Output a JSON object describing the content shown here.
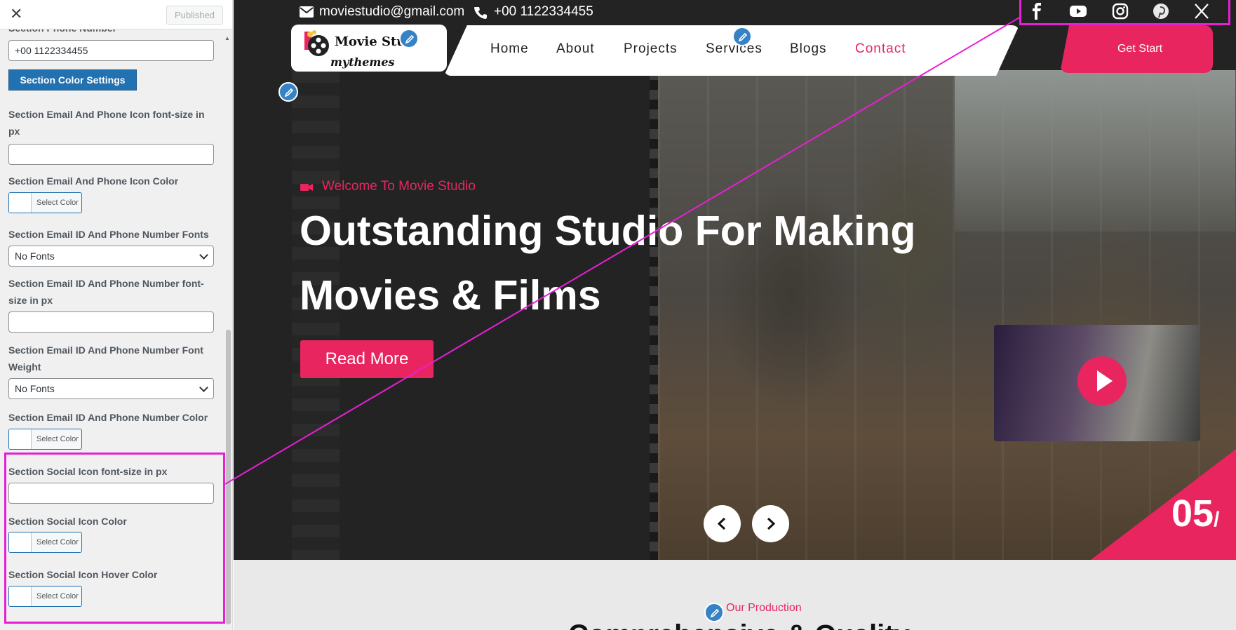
{
  "panel": {
    "close_glyph": "✕",
    "published_label": "Published",
    "phone_label": "Section Phone Number",
    "phone_value": "+00 1122334455",
    "color_settings_button": "Section Color Settings",
    "fields": {
      "icon_font_size_label": "Section Email And Phone Icon font-size in px",
      "icon_color_label": "Section Email And Phone Icon Color",
      "fonts_label": "Section Email ID And Phone Number Fonts",
      "fonts_value": "No Fonts",
      "text_font_size_label": "Section Email ID And Phone Number font-size in px",
      "font_weight_label": "Section Email ID And Phone Number Font Weight",
      "font_weight_value": "No Fonts",
      "text_color_label": "Section Email ID And Phone Number Color",
      "social_font_size_label": "Section Social Icon font-size in px",
      "social_color_label": "Section Social Icon Color",
      "social_hover_label": "Section Social Icon Hover Color"
    },
    "select_color_label": "Select Color"
  },
  "preview": {
    "topbar": {
      "email": "moviestudio@gmail.com",
      "phone": "+00 1122334455",
      "social_icons": [
        "facebook-icon",
        "youtube-icon",
        "instagram-icon",
        "pinterest-icon",
        "x-twitter-icon"
      ]
    },
    "logo": {
      "name": "Movie Studio",
      "subtitle": "mythemes"
    },
    "nav": [
      "Home",
      "About",
      "Projects",
      "Services",
      "Blogs",
      "Contact"
    ],
    "active_nav": "Contact",
    "cta_label": "Get Start",
    "hero": {
      "tagline": "Welcome To Movie Studio",
      "heading": "Outstanding Studio For Making Movies & Films",
      "read_more": "Read More",
      "slide_number": "05",
      "slide_sep": "/"
    },
    "production": {
      "label": "Our Production",
      "heading": "Comprehensive & Quality"
    }
  },
  "colors": {
    "accent": "#e8255f",
    "highlight": "#e71fd3",
    "wp_blue": "#2271b1"
  }
}
